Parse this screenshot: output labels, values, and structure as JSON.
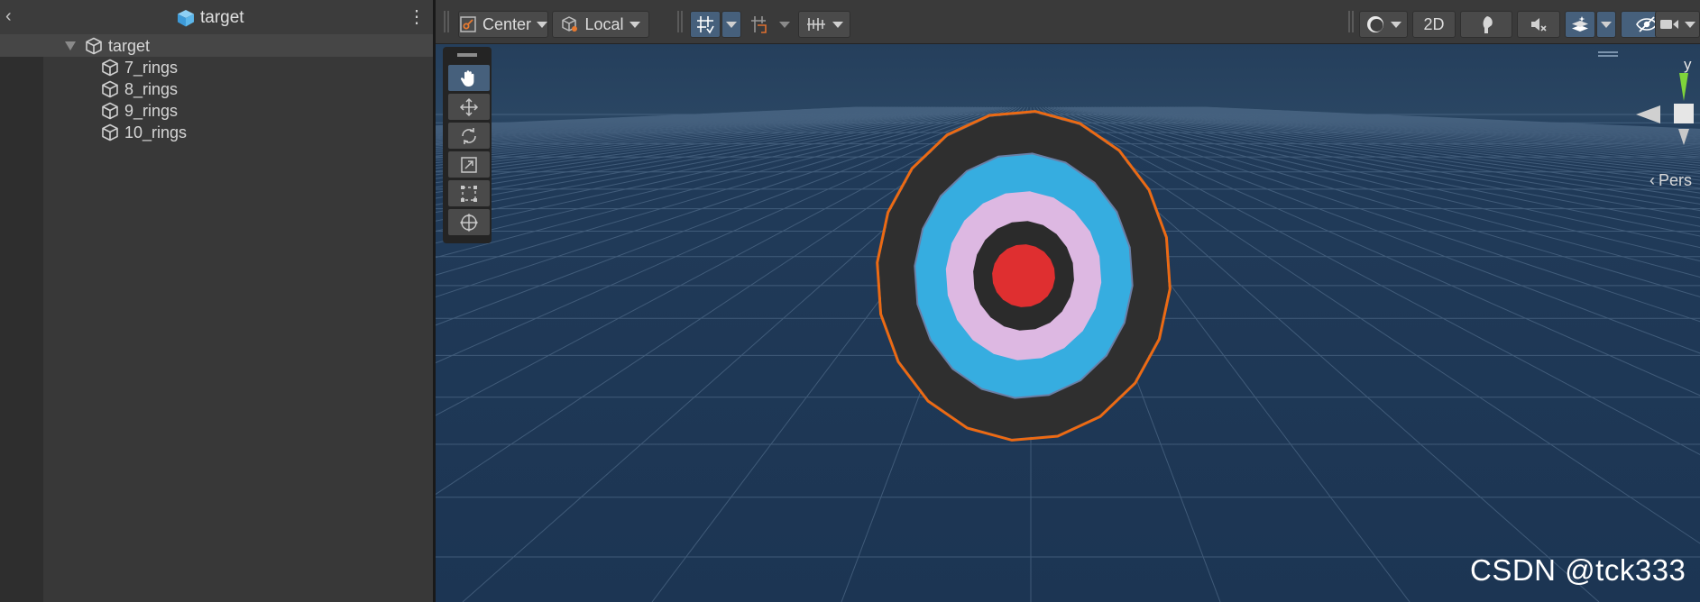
{
  "hierarchy": {
    "back_icon": "chevron-left-icon",
    "title": "target",
    "menu_icon": "kebab-menu-icon",
    "root": {
      "label": "target",
      "expanded": true
    },
    "children": [
      {
        "label": "7_rings"
      },
      {
        "label": "8_rings"
      },
      {
        "label": "9_rings"
      },
      {
        "label": "10_rings"
      }
    ]
  },
  "toolbar": {
    "pivot_mode": "Center",
    "pivot_rotation": "Local",
    "view_2d_label": "2D",
    "icons": [
      "grid-snap-icon",
      "increment-snap-icon",
      "ruler-icon",
      "draw-mode-icon",
      "lighting-icon",
      "audio-mute-icon",
      "effects-icon",
      "visibility-icon",
      "camera-icon"
    ]
  },
  "tools": [
    "hand-tool",
    "move-tool",
    "rotate-tool",
    "scale-tool",
    "rect-tool",
    "transform-tool"
  ],
  "gizmo": {
    "axis_label": "y",
    "projection": "Pers"
  },
  "target": {
    "ring_colors": [
      "#2f2f2f",
      "#36ade0",
      "#ddb8e2",
      "#2b2b2b",
      "#df2f30"
    ],
    "selection_outline": "#ec6a13"
  },
  "watermark": "CSDN @tck333"
}
